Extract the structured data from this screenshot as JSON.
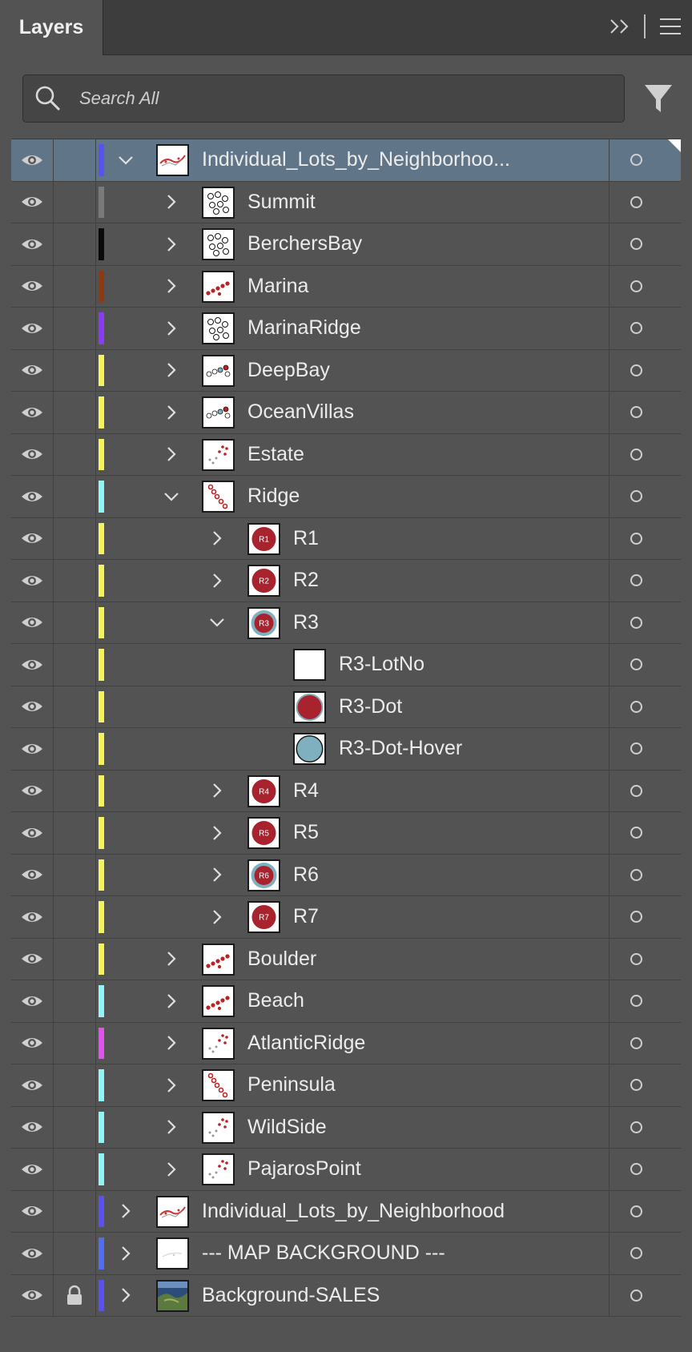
{
  "panel": {
    "tab_label": "Layers",
    "search_placeholder": "Search All"
  },
  "colors": {
    "panel_bg": "#535353",
    "selected_row": "#607588",
    "dot_red": "#a8232e",
    "dot_hover": "#7fb0c0"
  },
  "icons": {
    "visibility": "eye-icon",
    "lock": "lock-icon",
    "expand": "chevron-right-icon",
    "collapse": "chevron-down-icon",
    "search": "search-icon",
    "filter": "filter-icon",
    "menu": "hamburger-menu-icon",
    "collapse_panel": "double-chevron-icon",
    "target": "target-circle-icon"
  },
  "layers": [
    {
      "name": "Individual_Lots_by_Neighborhoo...",
      "depth": 0,
      "expand": "open",
      "color": "#5a52f0",
      "thumb": "map",
      "selected": true,
      "locked": false
    },
    {
      "name": "Summit",
      "depth": 1,
      "expand": "closed",
      "color": "#7a7a7a",
      "thumb": "cluster",
      "selected": false,
      "locked": false
    },
    {
      "name": "BerchersBay",
      "depth": 1,
      "expand": "closed",
      "color": "#0a0a0a",
      "thumb": "cluster",
      "selected": false,
      "locked": false
    },
    {
      "name": "Marina",
      "depth": 1,
      "expand": "closed",
      "color": "#8b3a12",
      "thumb": "reddots",
      "selected": false,
      "locked": false
    },
    {
      "name": "MarinaRidge",
      "depth": 1,
      "expand": "closed",
      "color": "#8a3cf5",
      "thumb": "cluster",
      "selected": false,
      "locked": false
    },
    {
      "name": "DeepBay",
      "depth": 1,
      "expand": "closed",
      "color": "#f5f55a",
      "thumb": "mixed",
      "selected": false,
      "locked": false
    },
    {
      "name": "OceanVillas",
      "depth": 1,
      "expand": "closed",
      "color": "#f5f55a",
      "thumb": "mixed",
      "selected": false,
      "locked": false
    },
    {
      "name": "Estate",
      "depth": 1,
      "expand": "closed",
      "color": "#f5f55a",
      "thumb": "sparse",
      "selected": false,
      "locked": false
    },
    {
      "name": "Ridge",
      "depth": 1,
      "expand": "open",
      "color": "#8ff5f5",
      "thumb": "diag",
      "selected": false,
      "locked": false
    },
    {
      "name": "R1",
      "depth": 2,
      "expand": "closed",
      "color": "#f5f55a",
      "thumb": "dot",
      "thumb_label": "R1",
      "selected": false,
      "locked": false
    },
    {
      "name": "R2",
      "depth": 2,
      "expand": "closed",
      "color": "#f5f55a",
      "thumb": "dot",
      "thumb_label": "R2",
      "selected": false,
      "locked": false
    },
    {
      "name": "R3",
      "depth": 2,
      "expand": "open",
      "color": "#f5f55a",
      "thumb": "dot-ring",
      "thumb_label": "R3",
      "selected": false,
      "locked": false
    },
    {
      "name": "R3-LotNo",
      "depth": 3,
      "expand": "none",
      "color": "#f5f55a",
      "thumb": "blank",
      "selected": false,
      "locked": false
    },
    {
      "name": "R3-Dot",
      "depth": 3,
      "expand": "none",
      "color": "#f5f55a",
      "thumb": "bigdot",
      "selected": false,
      "locked": false
    },
    {
      "name": "R3-Dot-Hover",
      "depth": 3,
      "expand": "none",
      "color": "#f5f55a",
      "thumb": "bigdot-hover",
      "selected": false,
      "locked": false
    },
    {
      "name": "R4",
      "depth": 2,
      "expand": "closed",
      "color": "#f5f55a",
      "thumb": "dot",
      "thumb_label": "R4",
      "selected": false,
      "locked": false
    },
    {
      "name": "R5",
      "depth": 2,
      "expand": "closed",
      "color": "#f5f55a",
      "thumb": "dot",
      "thumb_label": "R5",
      "selected": false,
      "locked": false
    },
    {
      "name": "R6",
      "depth": 2,
      "expand": "closed",
      "color": "#f5f55a",
      "thumb": "dot-ring",
      "thumb_label": "R6",
      "selected": false,
      "locked": false
    },
    {
      "name": "R7",
      "depth": 2,
      "expand": "closed",
      "color": "#f5f55a",
      "thumb": "dot",
      "thumb_label": "R7",
      "selected": false,
      "locked": false
    },
    {
      "name": "Boulder",
      "depth": 1,
      "expand": "closed",
      "color": "#f5f55a",
      "thumb": "reddots",
      "selected": false,
      "locked": false
    },
    {
      "name": "Beach",
      "depth": 1,
      "expand": "closed",
      "color": "#8ff5f5",
      "thumb": "reddots",
      "selected": false,
      "locked": false
    },
    {
      "name": "AtlanticRidge",
      "depth": 1,
      "expand": "closed",
      "color": "#e352f0",
      "thumb": "sparse",
      "selected": false,
      "locked": false
    },
    {
      "name": "Peninsula",
      "depth": 1,
      "expand": "closed",
      "color": "#8ff5f5",
      "thumb": "diag",
      "selected": false,
      "locked": false
    },
    {
      "name": "WildSide",
      "depth": 1,
      "expand": "closed",
      "color": "#8ff5f5",
      "thumb": "sparse",
      "selected": false,
      "locked": false
    },
    {
      "name": "PajarosPoint",
      "depth": 1,
      "expand": "closed",
      "color": "#8ff5f5",
      "thumb": "sparse",
      "selected": false,
      "locked": false
    },
    {
      "name": "Individual_Lots_by_Neighborhood",
      "depth": 0,
      "expand": "closed",
      "color": "#5a52f0",
      "thumb": "map",
      "selected": false,
      "locked": false
    },
    {
      "name": "--- MAP BACKGROUND ---",
      "depth": 0,
      "expand": "closed",
      "color": "#4f6ef0",
      "thumb": "faint",
      "selected": false,
      "locked": false
    },
    {
      "name": "Background-SALES",
      "depth": 0,
      "expand": "closed",
      "color": "#5a52f0",
      "thumb": "photo",
      "selected": false,
      "locked": true
    }
  ]
}
